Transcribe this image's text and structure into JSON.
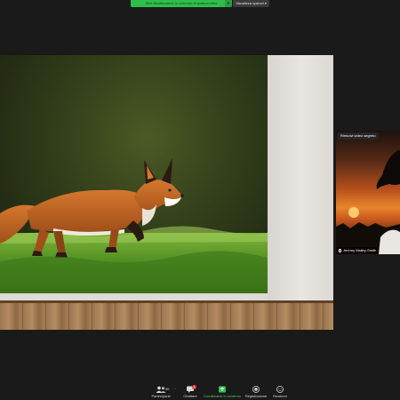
{
  "banner": {
    "sharing_text": "Stai visualizzando lo schermo di qualcun'altro",
    "view_options_label": "Visualizza opzioni"
  },
  "video": {
    "hide_label": "Rimuovi video segreto",
    "participant_name": "Jeremy Malley-Smith"
  },
  "toolbar": {
    "participants_label": "Partecipanti",
    "participants_count": "9K",
    "chat_label": "Chattare",
    "chat_badge": "3",
    "share_label": "Condividere lo schermo",
    "record_label": "Registrazione",
    "reactions_label": "Reazioni"
  },
  "colors": {
    "share_green": "#2fbd4c",
    "toolbar_bg": "#1a1a1a",
    "badge_red": "#e23b3b"
  },
  "icons": {
    "participants": "people-icon",
    "chat": "chat-bubble-icon",
    "share": "share-screen-icon",
    "record": "record-icon",
    "reactions": "smiley-icon"
  }
}
